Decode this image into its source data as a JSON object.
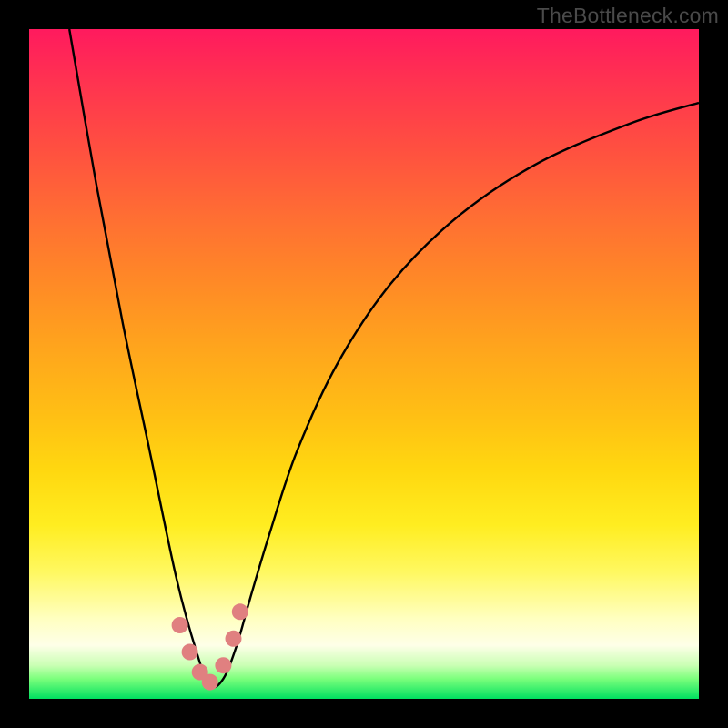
{
  "attribution": "TheBottleneck.com",
  "colors": {
    "frame": "#000000",
    "curve_stroke": "#000000",
    "marker_fill": "#e08080",
    "gradient_top": "#ff1a5e",
    "gradient_bottom": "#00e060"
  },
  "chart_data": {
    "type": "line",
    "title": "",
    "xlabel": "",
    "ylabel": "",
    "xlim": [
      0,
      100
    ],
    "ylim": [
      0,
      100
    ],
    "note": "Axes unlabeled; values are normalized percentages of plot area. Color gradient encodes y (red high → green low). Single V-shaped curve with minimum near x≈27, plus small cluster of salmon markers near the trough.",
    "series": [
      {
        "name": "bottleneck-curve",
        "x": [
          6,
          10,
          14,
          18,
          22,
          25,
          27,
          29,
          31,
          33,
          36,
          40,
          46,
          54,
          64,
          76,
          90,
          100
        ],
        "y": [
          100,
          77,
          56,
          37,
          18,
          7,
          2,
          3,
          8,
          15,
          25,
          37,
          50,
          62,
          72,
          80,
          86,
          89
        ]
      }
    ],
    "markers": {
      "name": "highlight-points",
      "x": [
        22.5,
        24,
        25.5,
        27,
        29,
        30.5,
        31.5
      ],
      "y": [
        11,
        7,
        4,
        2.5,
        5,
        9,
        13
      ]
    }
  }
}
